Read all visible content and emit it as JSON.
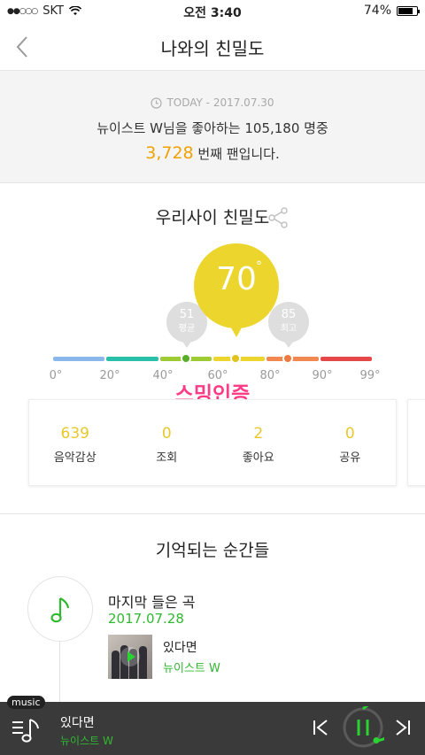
{
  "status": {
    "carrier": "SKT",
    "time": "오전 3:40",
    "battery": "74%",
    "battery_level": 0.74
  },
  "header": {
    "title": "나와의 친밀도",
    "back_icon": "chevron-left-icon"
  },
  "rank": {
    "today": "TODAY - 2017.07.30",
    "line1": "뉴이스트 W님을 좋아하는 105,180 명중",
    "rank_number": "3,728",
    "rank_suffix": " 번째 팬입니다."
  },
  "intimacy": {
    "title": "우리사이 친밀도",
    "value": "70",
    "degree": "°",
    "average": {
      "value": "51",
      "label": "평균"
    },
    "best": {
      "value": "85",
      "label": "최고"
    },
    "ticks": [
      "0°",
      "20°",
      "40°",
      "60°",
      "80°",
      "90°",
      "99°"
    ],
    "segment_colors": [
      "#8ab8ec",
      "#2abfa8",
      "#9ecb34",
      "#ecd52c",
      "#f08850",
      "#e44848"
    ],
    "stamp": "스밍인증"
  },
  "stats": [
    {
      "value": "639",
      "label": "음악감상"
    },
    {
      "value": "0",
      "label": "조회"
    },
    {
      "value": "2",
      "label": "좋아요"
    },
    {
      "value": "0",
      "label": "공유"
    }
  ],
  "memories": {
    "title": "기억되는 순간들",
    "item_title": "마지막 들은 곡",
    "date": "2017.07.28",
    "song": "있다면",
    "artist": "뉴이스트 W"
  },
  "player": {
    "badge": "music",
    "song": "있다면",
    "artist": "뉴이스트 W"
  }
}
